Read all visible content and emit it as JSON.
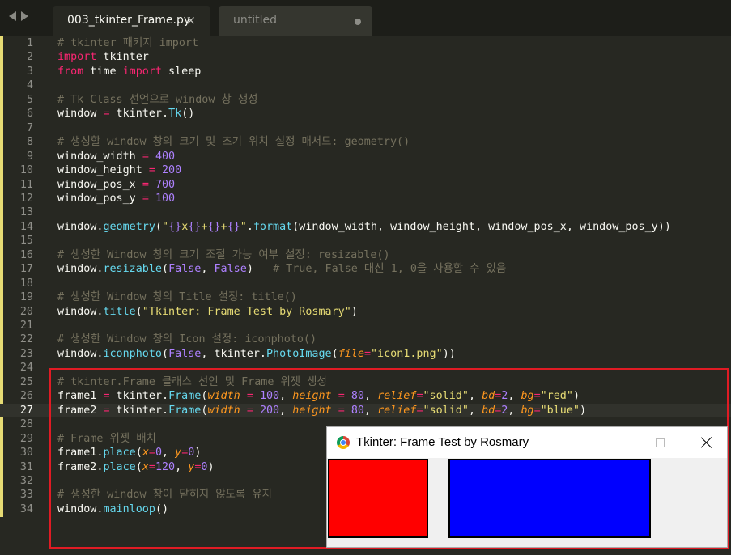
{
  "tabs": [
    {
      "label": "003_tkinter_Frame.py",
      "close": "×"
    },
    {
      "label": "untitled"
    }
  ],
  "editor": {
    "lines": [
      {
        "n": "1",
        "tokens": [
          [
            "c",
            "# tkinter 패키지 import"
          ]
        ]
      },
      {
        "n": "2",
        "tokens": [
          [
            "k",
            "import"
          ],
          [
            "",
            " tkinter"
          ]
        ]
      },
      {
        "n": "3",
        "tokens": [
          [
            "k",
            "from"
          ],
          [
            "",
            " time "
          ],
          [
            "k",
            "import"
          ],
          [
            "",
            " sleep"
          ]
        ]
      },
      {
        "n": "4",
        "tokens": []
      },
      {
        "n": "5",
        "tokens": [
          [
            "c",
            "# Tk Class 선언으로 window 창 생성"
          ]
        ]
      },
      {
        "n": "6",
        "tokens": [
          [
            "",
            "window "
          ],
          [
            "o",
            "="
          ],
          [
            "",
            " tkinter."
          ],
          [
            "f",
            "Tk"
          ],
          [
            "",
            "()"
          ]
        ]
      },
      {
        "n": "7",
        "tokens": []
      },
      {
        "n": "8",
        "tokens": [
          [
            "c",
            "# 생성할 window 창의 크기 및 초기 위치 설정 매서드: geometry()"
          ]
        ]
      },
      {
        "n": "9",
        "tokens": [
          [
            "",
            "window_width "
          ],
          [
            "o",
            "="
          ],
          [
            "",
            " "
          ],
          [
            "n",
            "400"
          ]
        ]
      },
      {
        "n": "10",
        "tokens": [
          [
            "",
            "window_height "
          ],
          [
            "o",
            "="
          ],
          [
            "",
            " "
          ],
          [
            "n",
            "200"
          ]
        ]
      },
      {
        "n": "11",
        "tokens": [
          [
            "",
            "window_pos_x "
          ],
          [
            "o",
            "="
          ],
          [
            "",
            " "
          ],
          [
            "n",
            "700"
          ]
        ]
      },
      {
        "n": "12",
        "tokens": [
          [
            "",
            "window_pos_y "
          ],
          [
            "o",
            "="
          ],
          [
            "",
            " "
          ],
          [
            "n",
            "100"
          ]
        ]
      },
      {
        "n": "13",
        "tokens": []
      },
      {
        "n": "14",
        "tokens": [
          [
            "",
            "window."
          ],
          [
            "f",
            "geometry"
          ],
          [
            "",
            "("
          ],
          [
            "s",
            "\""
          ],
          [
            "n",
            "{}"
          ],
          [
            "s",
            "x"
          ],
          [
            "n",
            "{}"
          ],
          [
            "s",
            "+"
          ],
          [
            "n",
            "{}"
          ],
          [
            "s",
            "+"
          ],
          [
            "n",
            "{}"
          ],
          [
            "s",
            "\""
          ],
          [
            "",
            "."
          ],
          [
            "f",
            "format"
          ],
          [
            "",
            "(window_width, window_height, window_pos_x, window_pos_y))"
          ]
        ]
      },
      {
        "n": "15",
        "tokens": []
      },
      {
        "n": "16",
        "tokens": [
          [
            "c",
            "# 생성한 Window 창의 크기 조절 가능 여부 설정: resizable()"
          ]
        ]
      },
      {
        "n": "17",
        "tokens": [
          [
            "",
            "window."
          ],
          [
            "f",
            "resizable"
          ],
          [
            "",
            "("
          ],
          [
            "n",
            "False"
          ],
          [
            "",
            ", "
          ],
          [
            "n",
            "False"
          ],
          [
            "",
            ")   "
          ],
          [
            "c",
            "# True, False 대신 1, 0을 사용할 수 있음"
          ]
        ]
      },
      {
        "n": "18",
        "tokens": []
      },
      {
        "n": "19",
        "tokens": [
          [
            "c",
            "# 생성한 Window 창의 Title 설정: title()"
          ]
        ]
      },
      {
        "n": "20",
        "tokens": [
          [
            "",
            "window."
          ],
          [
            "f",
            "title"
          ],
          [
            "",
            "("
          ],
          [
            "s",
            "\"Tkinter: Frame Test by Rosmary\""
          ],
          [
            "",
            ")"
          ]
        ]
      },
      {
        "n": "21",
        "tokens": []
      },
      {
        "n": "22",
        "tokens": [
          [
            "c",
            "# 생성한 Window 창의 Icon 설정: iconphoto()"
          ]
        ]
      },
      {
        "n": "23",
        "tokens": [
          [
            "",
            "window."
          ],
          [
            "f",
            "iconphoto"
          ],
          [
            "",
            "("
          ],
          [
            "n",
            "False"
          ],
          [
            "",
            ", tkinter."
          ],
          [
            "f",
            "PhotoImage"
          ],
          [
            "",
            "("
          ],
          [
            "p",
            "file"
          ],
          [
            "o",
            "="
          ],
          [
            "s",
            "\"icon1.png\""
          ],
          [
            "",
            "))"
          ]
        ]
      },
      {
        "n": "24",
        "tokens": []
      },
      {
        "n": "25",
        "tokens": [
          [
            "c",
            "# tkinter.Frame 클래스 선언 및 Frame 위젯 생성"
          ]
        ]
      },
      {
        "n": "26",
        "tokens": [
          [
            "",
            "frame1 "
          ],
          [
            "o",
            "="
          ],
          [
            "",
            " tkinter."
          ],
          [
            "f",
            "Frame"
          ],
          [
            "",
            "("
          ],
          [
            "p",
            "width"
          ],
          [
            "",
            " "
          ],
          [
            "o",
            "="
          ],
          [
            "",
            " "
          ],
          [
            "n",
            "100"
          ],
          [
            "",
            ", "
          ],
          [
            "p",
            "height"
          ],
          [
            "",
            " "
          ],
          [
            "o",
            "="
          ],
          [
            "",
            " "
          ],
          [
            "n",
            "80"
          ],
          [
            "",
            ", "
          ],
          [
            "p",
            "relief"
          ],
          [
            "o",
            "="
          ],
          [
            "s",
            "\"solid\""
          ],
          [
            "",
            ", "
          ],
          [
            "p",
            "bd"
          ],
          [
            "o",
            "="
          ],
          [
            "n",
            "2"
          ],
          [
            "",
            ", "
          ],
          [
            "p",
            "bg"
          ],
          [
            "o",
            "="
          ],
          [
            "s",
            "\"red\""
          ],
          [
            "",
            ")"
          ]
        ]
      },
      {
        "n": "27",
        "current": true,
        "tokens": [
          [
            "",
            "frame2 "
          ],
          [
            "o",
            "="
          ],
          [
            "",
            " tkinter."
          ],
          [
            "f",
            "Frame"
          ],
          [
            "",
            "("
          ],
          [
            "p",
            "width"
          ],
          [
            "",
            " "
          ],
          [
            "o",
            "="
          ],
          [
            "",
            " "
          ],
          [
            "n",
            "200"
          ],
          [
            "",
            ", "
          ],
          [
            "p",
            "height"
          ],
          [
            "",
            " "
          ],
          [
            "o",
            "="
          ],
          [
            "",
            " "
          ],
          [
            "n",
            "80"
          ],
          [
            "",
            ", "
          ],
          [
            "p",
            "relief"
          ],
          [
            "o",
            "="
          ],
          [
            "s",
            "\"solid\""
          ],
          [
            "",
            ", "
          ],
          [
            "p",
            "bd"
          ],
          [
            "o",
            "="
          ],
          [
            "n",
            "2"
          ],
          [
            "",
            ", "
          ],
          [
            "p",
            "bg"
          ],
          [
            "o",
            "="
          ],
          [
            "s",
            "\"blue\""
          ],
          [
            "",
            ")"
          ]
        ]
      },
      {
        "n": "28",
        "tokens": []
      },
      {
        "n": "29",
        "tokens": [
          [
            "c",
            "# Frame 위젯 배치"
          ]
        ]
      },
      {
        "n": "30",
        "tokens": [
          [
            "",
            "frame1."
          ],
          [
            "f",
            "place"
          ],
          [
            "",
            "("
          ],
          [
            "p",
            "x"
          ],
          [
            "o",
            "="
          ],
          [
            "n",
            "0"
          ],
          [
            "",
            ", "
          ],
          [
            "p",
            "y"
          ],
          [
            "o",
            "="
          ],
          [
            "n",
            "0"
          ],
          [
            "",
            ")"
          ]
        ]
      },
      {
        "n": "31",
        "tokens": [
          [
            "",
            "frame2."
          ],
          [
            "f",
            "place"
          ],
          [
            "",
            "("
          ],
          [
            "p",
            "x"
          ],
          [
            "o",
            "="
          ],
          [
            "n",
            "120"
          ],
          [
            "",
            ", "
          ],
          [
            "p",
            "y"
          ],
          [
            "o",
            "="
          ],
          [
            "n",
            "0"
          ],
          [
            "",
            ")"
          ]
        ]
      },
      {
        "n": "32",
        "tokens": []
      },
      {
        "n": "33",
        "tokens": [
          [
            "c",
            "# 생성한 window 창이 닫히지 않도록 유지"
          ]
        ]
      },
      {
        "n": "34",
        "tokens": [
          [
            "",
            "window."
          ],
          [
            "f",
            "mainloop"
          ],
          [
            "",
            "()"
          ]
        ]
      }
    ]
  },
  "tk_window": {
    "title": "Tkinter: Frame Test by Rosmary",
    "icon": "chrome-icon",
    "frames": [
      {
        "name": "frame1",
        "color": "#ff0000"
      },
      {
        "name": "frame2",
        "color": "#0000ff"
      }
    ]
  },
  "colors": {
    "background": "#272822",
    "comment": "#75715e",
    "keyword": "#f92672",
    "number": "#ae81ff",
    "string": "#e6db74",
    "function": "#66d9ef",
    "parameter": "#fd971f",
    "highlight_box": "#e01b24"
  }
}
